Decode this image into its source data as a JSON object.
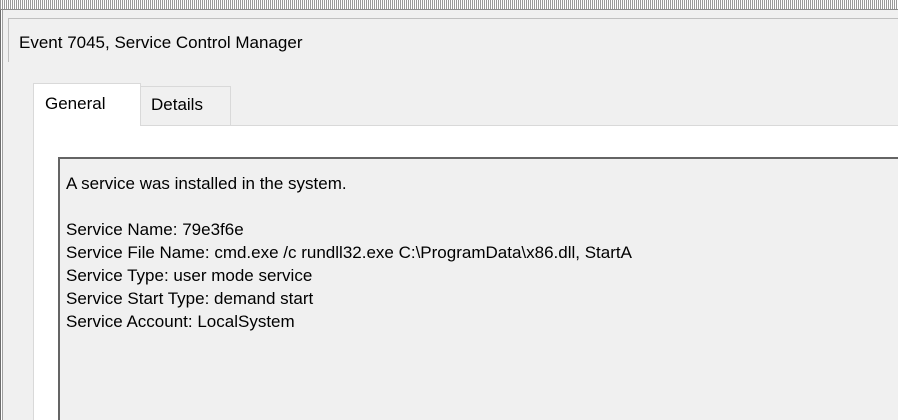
{
  "header": {
    "title": "Event 7045, Service Control Manager"
  },
  "tabs": [
    {
      "label": "General",
      "selected": true
    },
    {
      "label": "Details",
      "selected": false
    }
  ],
  "message": {
    "summary": "A service was installed in the system.",
    "fields": [
      "Service Name:  79e3f6e",
      "Service File Name:  cmd.exe /c rundll32.exe C:\\ProgramData\\x86.dll, StartA",
      "Service Type:  user mode service",
      "Service Start Type:  demand start",
      "Service Account:  LocalSystem"
    ]
  }
}
